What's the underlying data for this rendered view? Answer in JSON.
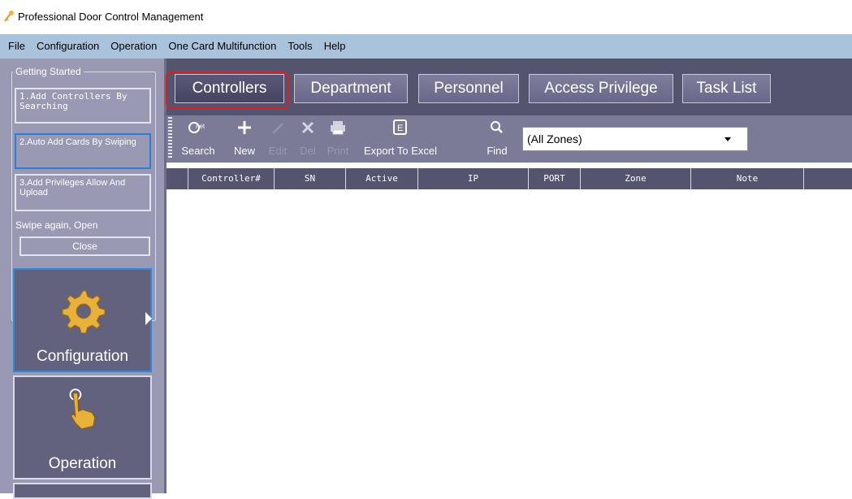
{
  "window": {
    "title": "Professional Door Control Management"
  },
  "menu": [
    "File",
    "Configuration",
    "Operation",
    "One Card Multifunction",
    "Tools",
    "Help"
  ],
  "getting_started": {
    "legend": "Getting Started",
    "step1": "1.Add Controllers By Searching",
    "step2": "2.Auto Add Cards By Swiping",
    "step3": "3.Add Privileges Allow And Upload",
    "note": "Swipe again, Open",
    "close": "Close"
  },
  "nav": {
    "configuration": "Configuration",
    "operation": "Operation",
    "active": "Configuration"
  },
  "tabs": {
    "controllers": "Controllers",
    "department": "Department",
    "personnel": "Personnel",
    "access_privilege": "Access Privilege",
    "task_list": "Task List",
    "active": "Controllers"
  },
  "toolbar": {
    "search": "Search",
    "new": "New",
    "edit": "Edit",
    "del": "Del",
    "print": "Print",
    "export": "Export To Excel",
    "find": "Find",
    "disabled": [
      "Edit",
      "Del",
      "Print"
    ]
  },
  "zone_filter": {
    "selected": "(All Zones)"
  },
  "grid": {
    "columns": [
      "Controller#",
      "SN",
      "Active",
      "IP",
      "PORT",
      "Zone",
      "Note"
    ],
    "rows": []
  },
  "colors": {
    "menubar": "#a9c3dd",
    "nav_bg": "#9a99b3",
    "tile_bg": "#62617e",
    "tabstrip": "#55546f",
    "toolbar": "#7b7a97",
    "highlight": "#e21c1c",
    "active_border": "#2a8ae0"
  }
}
